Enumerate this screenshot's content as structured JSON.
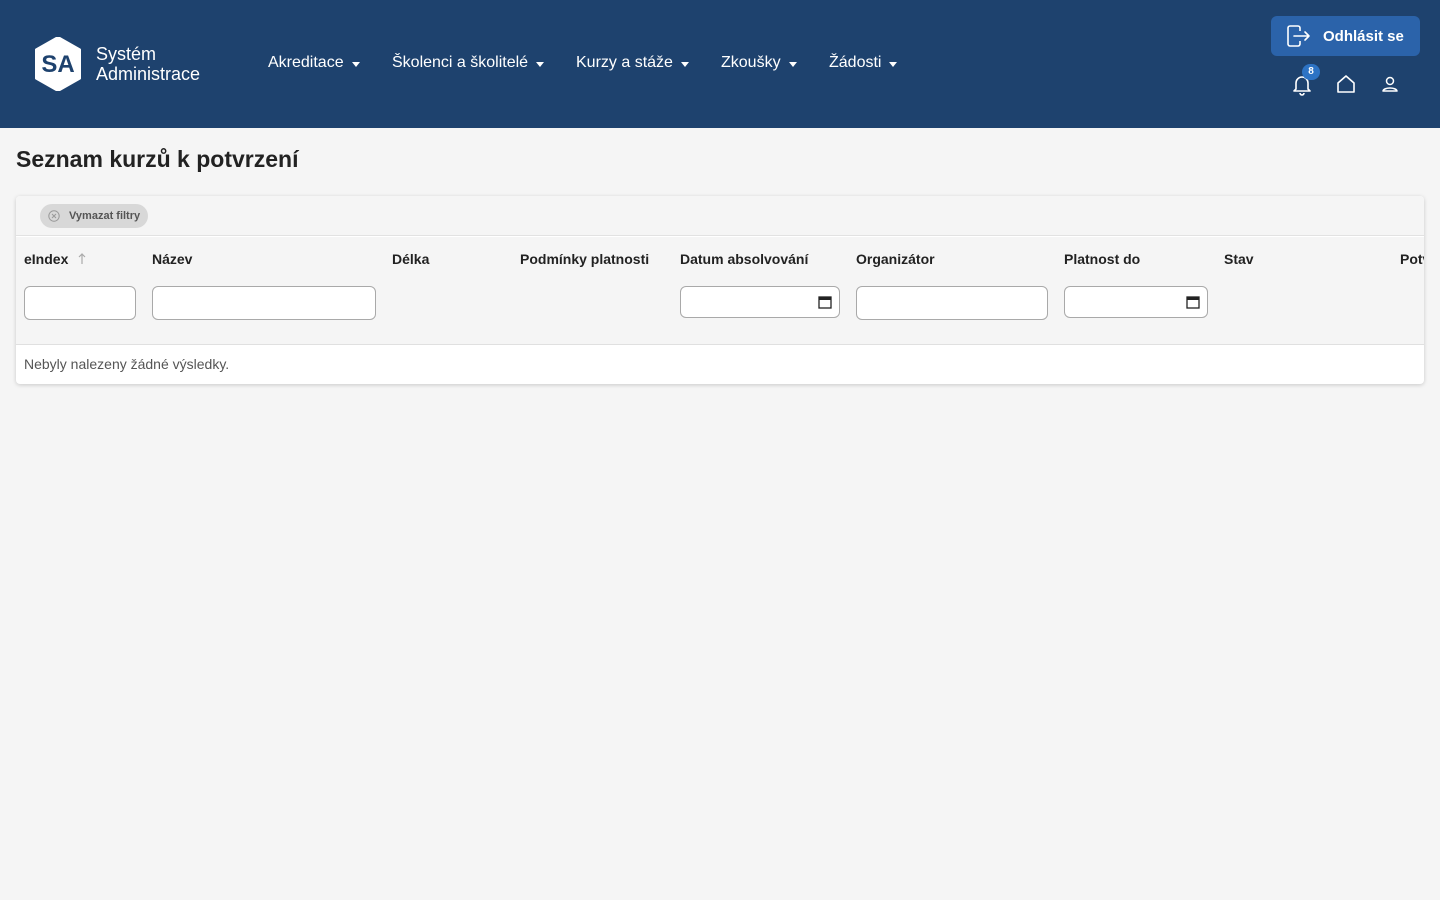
{
  "brand": {
    "logo_text": "SA",
    "line1": "Systém",
    "line2": "Administrace"
  },
  "nav": {
    "items": [
      {
        "label": "Akreditace"
      },
      {
        "label": "Školenci a školitelé"
      },
      {
        "label": "Kurzy a stáže"
      },
      {
        "label": "Zkoušky"
      },
      {
        "label": "Žádosti"
      }
    ],
    "logout_label": "Odhlásit se",
    "notification_count": "8",
    "icons": [
      "logout-icon",
      "bell-icon",
      "home-icon",
      "user-icon"
    ]
  },
  "page": {
    "title": "Seznam kurzů k potvrzení"
  },
  "table": {
    "clear_filters_label": "Vymazat filtry",
    "columns": [
      {
        "label": "eIndex",
        "sorted": "ascending"
      },
      {
        "label": "Název"
      },
      {
        "label": "Délka"
      },
      {
        "label": "Podmínky platnosti"
      },
      {
        "label": "Datum absolvování"
      },
      {
        "label": "Organizátor"
      },
      {
        "label": "Platnost do"
      },
      {
        "label": "Stav"
      },
      {
        "label": "Potv"
      }
    ],
    "filters": {
      "eindex": "",
      "nazev": "",
      "datum_absolvovani": "",
      "organizator": "",
      "platnost_do": ""
    },
    "empty_message": "Nebyly nalezeny žádné výsledky."
  },
  "colors": {
    "navbar": "#1e426e",
    "logout_button": "#2b63aa",
    "badge": "#2d73c4",
    "page_background": "#f5f5f5"
  }
}
